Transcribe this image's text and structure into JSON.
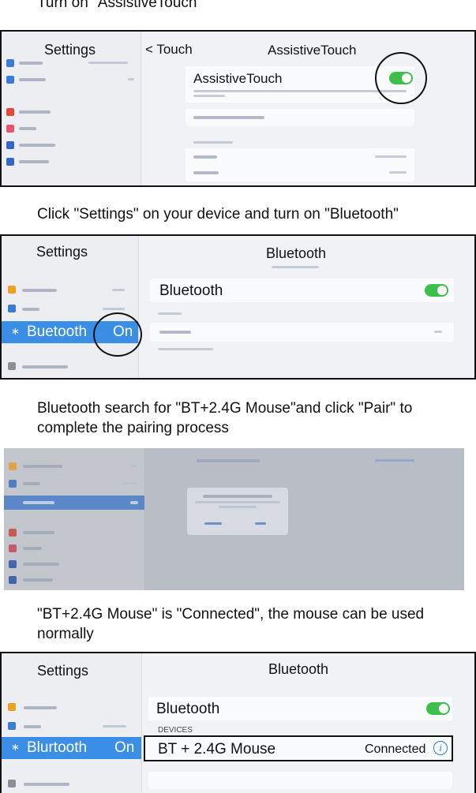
{
  "step1": {
    "instruction": "Turn on \"AssistiveTouch\"",
    "settings_title": "Settings",
    "back_label": "< Touch",
    "page_title": "AssistiveTouch",
    "row_label": "AssistiveTouch"
  },
  "step2": {
    "instruction": "Click \"Settings\" on your device and turn on \"Bluetooth\"",
    "settings_title": "Settings",
    "page_title": "Bluetooth",
    "row_label": "Bluetooth",
    "sidebar_selected_label": "Buetooth",
    "sidebar_selected_value": "On"
  },
  "step3": {
    "instruction_line1": "Bluetooth search for \"BT+2.4G Mouse\"and click \"Pair\" to",
    "instruction_line2": "complete the pairing process"
  },
  "step4": {
    "instruction_line1": "\"BT+2.4G Mouse\" is \"Connected\", the mouse can be used",
    "instruction_line2": "normally",
    "settings_title": "Settings",
    "page_title": "Bluetooth",
    "row_label": "Bluetooth",
    "section_label": "DEVICES",
    "device_name": "BT + 2.4G Mouse",
    "device_status": "Connected",
    "sidebar_selected_label": "Blurtooth",
    "sidebar_selected_value": "On"
  },
  "colors": {
    "accent": "#3a8ee6",
    "toggle": "#3ebf4b",
    "info": "#2a7de1"
  }
}
